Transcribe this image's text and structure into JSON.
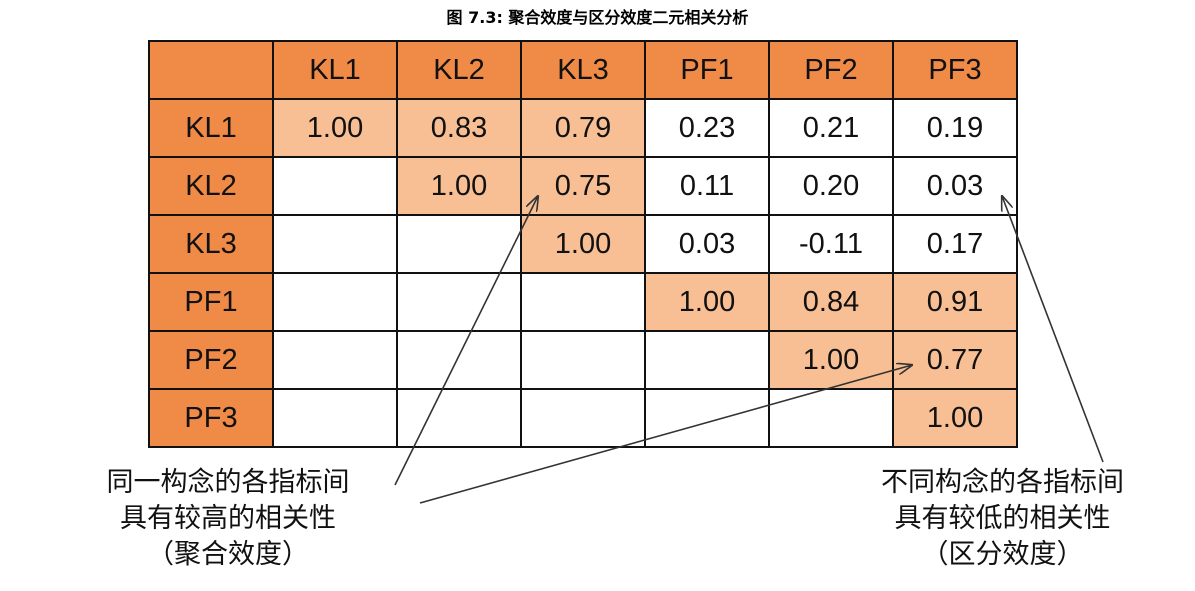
{
  "chart_data": {
    "type": "table",
    "title": "图 7.3: 聚合效度与区分效度二元相关分析",
    "columns": [
      "KL1",
      "KL2",
      "KL3",
      "PF1",
      "PF2",
      "PF3"
    ],
    "rows": [
      {
        "label": "KL1",
        "values": [
          "1.00",
          "0.83",
          "0.79",
          "0.23",
          "0.21",
          "0.19"
        ]
      },
      {
        "label": "KL2",
        "values": [
          "",
          "1.00",
          "0.75",
          "0.11",
          "0.20",
          "0.03"
        ]
      },
      {
        "label": "KL3",
        "values": [
          "",
          "",
          "1.00",
          "0.03",
          "-0.11",
          "0.17"
        ]
      },
      {
        "label": "PF1",
        "values": [
          "",
          "",
          "",
          "1.00",
          "0.84",
          "0.91"
        ]
      },
      {
        "label": "PF2",
        "values": [
          "",
          "",
          "",
          "",
          "1.00",
          "0.77"
        ]
      },
      {
        "label": "PF3",
        "values": [
          "",
          "",
          "",
          "",
          "",
          "1.00"
        ]
      }
    ],
    "highlighted_cells": [
      [
        0,
        0
      ],
      [
        0,
        1
      ],
      [
        0,
        2
      ],
      [
        1,
        1
      ],
      [
        1,
        2
      ],
      [
        2,
        2
      ],
      [
        3,
        3
      ],
      [
        3,
        4
      ],
      [
        3,
        5
      ],
      [
        4,
        4
      ],
      [
        4,
        5
      ],
      [
        5,
        5
      ]
    ],
    "colors": {
      "header": "#ef8a47",
      "highlight": "#f8bf95",
      "plain": "#ffffff"
    }
  },
  "annotations": {
    "left": {
      "lines": [
        "同一构念的各指标间",
        "具有较高的相关性",
        "（聚合效度）"
      ]
    },
    "right": {
      "lines": [
        "不同构念的各指标间",
        "具有较低的相关性",
        "（区分效度）"
      ]
    }
  }
}
